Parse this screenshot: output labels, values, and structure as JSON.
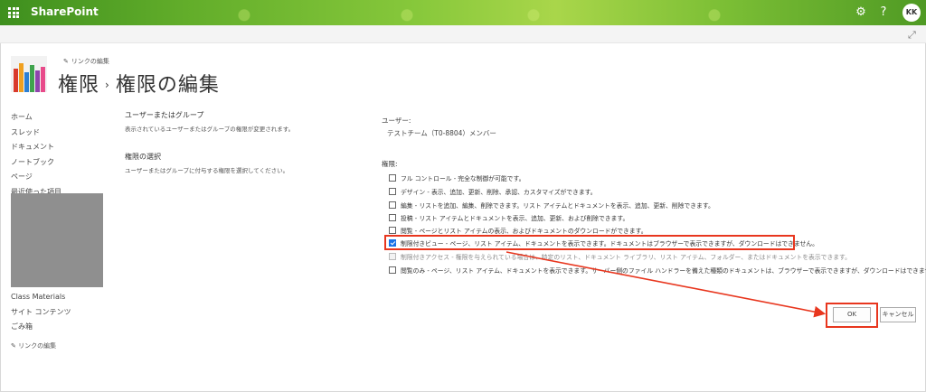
{
  "suite": {
    "brand": "SharePoint",
    "user_initials": "KK",
    "settings_icon": "gear-icon",
    "help_icon": "help-icon"
  },
  "header": {
    "edit_links": "リンクの編集",
    "breadcrumb_parent": "権限",
    "breadcrumb_separator": "›",
    "title": "権限の編集"
  },
  "nav": {
    "items": [
      "ホーム",
      "スレッド",
      "ドキュメント",
      "ノートブック",
      "ページ",
      "最近使った項目"
    ],
    "lower_items": [
      "Class Materials",
      "サイト コンテンツ",
      "ごみ箱"
    ],
    "edit_links": "リンクの編集"
  },
  "sections": {
    "users_title": "ユーザーまたはグループ",
    "users_desc": "表示されているユーザーまたはグループの権限が変更されます。",
    "perm_title": "権限の選択",
    "perm_desc": "ユーザーまたはグループに付与する権限を選択してください。"
  },
  "users": {
    "label": "ユーザー:",
    "value": "テストチーム（T0-8804）メンバー"
  },
  "permissions": {
    "label": "権限:",
    "items": [
      {
        "text": "フル コントロール - 完全な制御が可能です。",
        "checked": false,
        "disabled": false
      },
      {
        "text": "デザイン - 表示、追加、更新、削除、承認、カスタマイズができます。",
        "checked": false,
        "disabled": false
      },
      {
        "text": "編集 - リストを追加、編集、削除できます。リスト アイテムとドキュメントを表示、追加、更新、削除できます。",
        "checked": false,
        "disabled": false
      },
      {
        "text": "投稿 - リスト アイテムとドキュメントを表示、追加、更新、および削除できます。",
        "checked": false,
        "disabled": false
      },
      {
        "text": "閲覧 - ページとリスト アイテムの表示、およびドキュメントのダウンロードができます。",
        "checked": false,
        "disabled": false
      },
      {
        "text": "制限付きビュー - ページ、リスト アイテム、ドキュメントを表示できます。ドキュメントはブラウザーで表示できますが、ダウンロードはできません。",
        "checked": true,
        "disabled": false
      },
      {
        "text": "制限付きアクセス - 権限を与えられている場合は、特定のリスト、ドキュメント ライブラリ、リスト アイテム、フォルダー、またはドキュメントを表示できます。",
        "checked": false,
        "disabled": true
      },
      {
        "text": "閲覧のみ - ページ、リスト アイテム、ドキュメントを表示できます。サーバー側のファイル ハンドラーを備えた種類のドキュメントは、ブラウザーで表示できますが、ダウンロードはできません。",
        "checked": false,
        "disabled": false
      }
    ]
  },
  "buttons": {
    "ok": "OK",
    "cancel": "キャンセル"
  },
  "colors": {
    "annotation": "#e8361e",
    "checkbox_checked": "#1a73e8"
  }
}
